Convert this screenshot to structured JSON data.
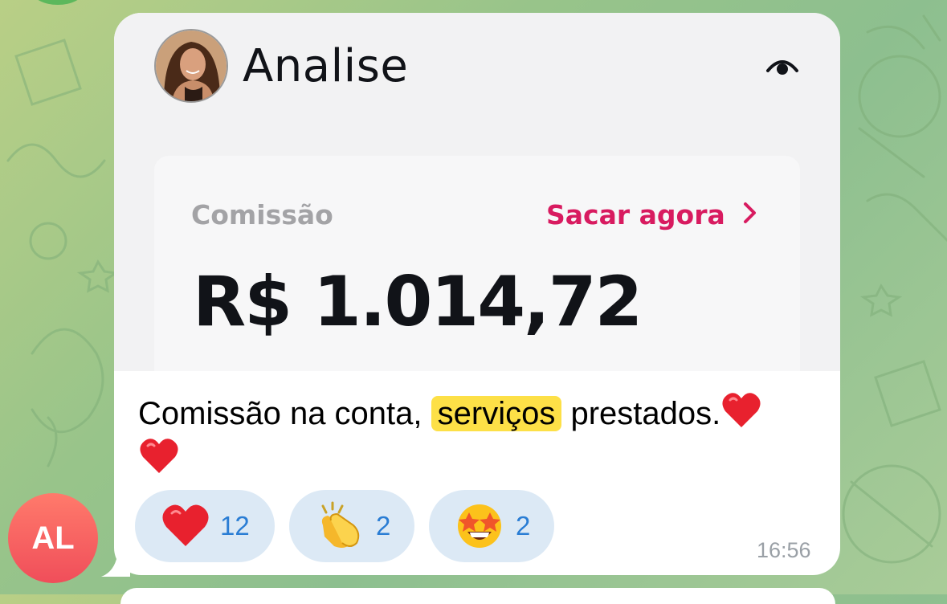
{
  "colors": {
    "accent_link": "#d81b60",
    "reaction_bg": "#dce9f5",
    "reaction_count": "#2a7dd4",
    "highlight": "#fde047",
    "avatar_gradient": [
      "#ff7a6b",
      "#f04e5a"
    ]
  },
  "message": {
    "profile": {
      "name": "Analise",
      "photo_icon": "profile-photo",
      "visibility_icon": "eye-icon"
    },
    "card": {
      "label": "Comissão",
      "link": "Sacar agora",
      "link_icon": "chevron-right-icon",
      "amount": "R$ 1.014,72"
    },
    "caption": {
      "before": "Comissão na conta, ",
      "highlighted": "serviços",
      "after": " prestados."
    },
    "reactions": [
      {
        "emoji": "red-heart-icon",
        "count": "12"
      },
      {
        "emoji": "clapping-hands-icon",
        "count": "2"
      },
      {
        "emoji": "star-struck-icon",
        "count": "2"
      }
    ],
    "time": "16:56"
  },
  "sender": {
    "initials": "AL"
  }
}
